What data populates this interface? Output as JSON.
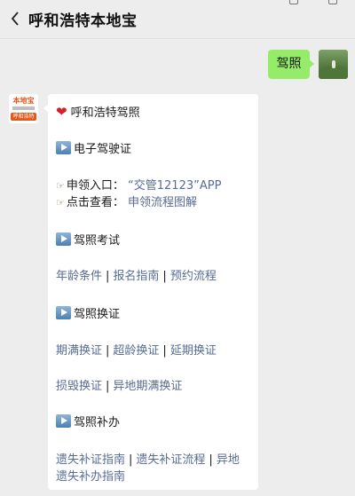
{
  "header": {
    "title": "呼和浩特本地宝"
  },
  "user_message": {
    "text": "驾照"
  },
  "bot": {
    "avatar_brand": "本地宝",
    "avatar_city": "呼和浩特",
    "intro": "呼和浩特驾照",
    "sections": [
      {
        "heading": "电子驾驶证",
        "entries": [
          {
            "label": "申领入口：",
            "link": "“交管12123”APP"
          },
          {
            "label": "点击查看：",
            "link": "申领流程图解"
          }
        ]
      },
      {
        "heading": "驾照考试",
        "links": [
          "年龄条件",
          "报名指南",
          "预约流程"
        ]
      },
      {
        "heading": "驾照换证",
        "links_row1": [
          "期满换证",
          "超龄换证",
          "延期换证"
        ],
        "links_row2": [
          "损毁换证",
          "异地期满换证"
        ]
      },
      {
        "heading": "驾照补办",
        "links_row1": [
          "遗失补证指南",
          "遗失补证流程",
          "异地"
        ],
        "links_row2": [
          "遗失补办指南"
        ]
      }
    ]
  },
  "colors": {
    "background": "#ededed",
    "user_bubble": "#95ec69",
    "link": "#576b95",
    "heart": "#d81e2b"
  },
  "icons": {
    "back": "chevron-left-icon",
    "heart": "heart-icon",
    "play": "play-button-icon",
    "pointing_hand": "pointing-hand-icon"
  }
}
